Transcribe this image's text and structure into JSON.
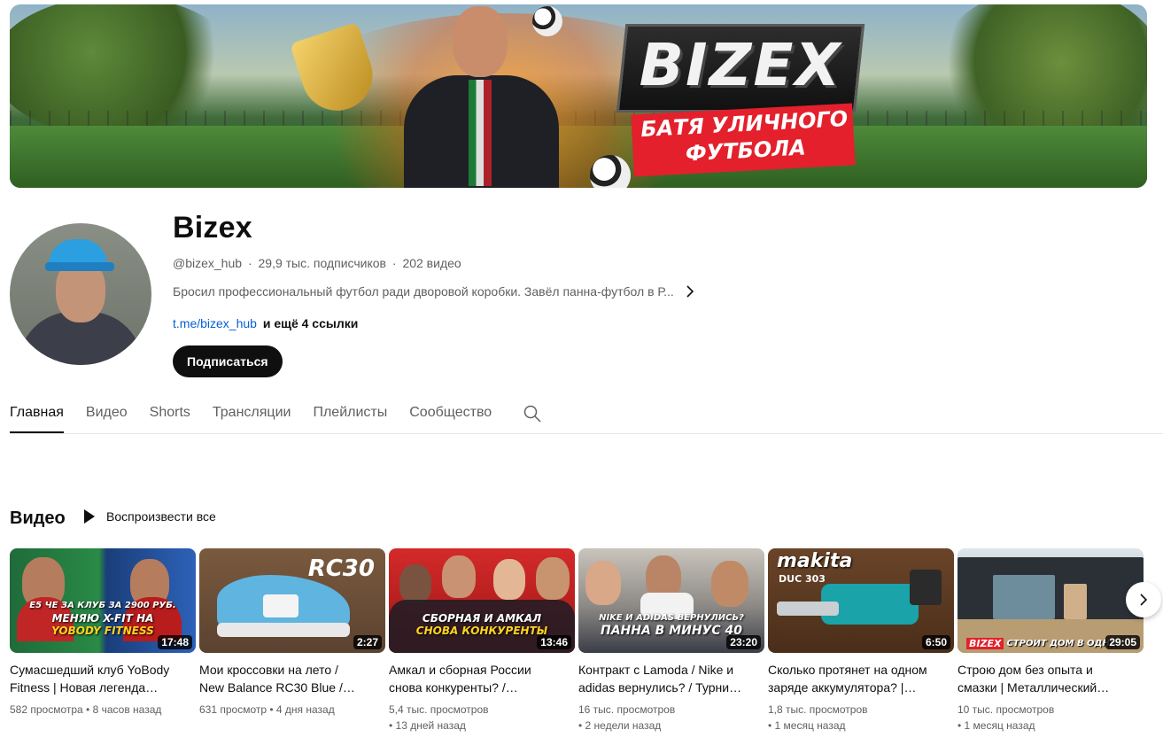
{
  "banner": {
    "logo": "BIZEX",
    "subtitle_line1": "БАТЯ УЛИЧНОГО",
    "subtitle_line2": "ФУТБОЛА"
  },
  "channel": {
    "name": "Bizex",
    "handle": "@bizex_hub",
    "subscribers": "29,9 тыс. подписчиков",
    "video_count": "202 видео",
    "separator": "·",
    "description": "Бросил профессиональный футбол ради дворовой коробки. Завёл панна-футбол в Р...",
    "link": "t.me/bizex_hub",
    "more_links": "и ещё 4 ссылки",
    "subscribe_label": "Подписаться"
  },
  "tabs": [
    {
      "label": "Главная",
      "active": true
    },
    {
      "label": "Видео",
      "active": false
    },
    {
      "label": "Shorts",
      "active": false
    },
    {
      "label": "Трансляции",
      "active": false
    },
    {
      "label": "Плейлисты",
      "active": false
    },
    {
      "label": "Сообщество",
      "active": false
    }
  ],
  "section": {
    "title": "Видео",
    "play_all": "Воспроизвести все"
  },
  "videos": [
    {
      "title_line1": "Сумасшедший клуб YoBody",
      "title_line2": "Fitness | Новая легенда…",
      "meta_line1": "582 просмотра • 8 часов назад",
      "meta_line2": "",
      "duration": "17:48",
      "thumb_text1": "Е5 ЧЕ ЗА КЛУБ ЗА 2900 РУБ.",
      "thumb_text2": "МЕНЯЮ X-FIT НА",
      "thumb_text3": "YOBODY FITNESS"
    },
    {
      "title_line1": "Мои кроссовки на лето /",
      "title_line2": "New Balance RC30 Blue /…",
      "meta_line1": "631 просмотр • 4 дня назад",
      "meta_line2": "",
      "duration": "2:27",
      "thumb_text1": "RC30"
    },
    {
      "title_line1": "Амкал и сборная России",
      "title_line2": "снова конкуренты? /…",
      "meta_line1": "5,4 тыс. просмотров",
      "meta_line2": "• 13 дней назад",
      "duration": "13:46",
      "thumb_text1": "СБОРНАЯ И АМКАЛ",
      "thumb_text2": "СНОВА КОНКУРЕНТЫ"
    },
    {
      "title_line1": "Контракт с Lamoda / Nike и",
      "title_line2": "adidas вернулись? / Турни…",
      "meta_line1": "16 тыс. просмотров",
      "meta_line2": "• 2 недели назад",
      "duration": "23:20",
      "thumb_text1": "NIKE И ADIDAS ВЕРНУЛИСЬ?",
      "thumb_text2": "ПАННА В МИНУС 40"
    },
    {
      "title_line1": "Сколько протянет на одном",
      "title_line2": "заряде аккумулятора? |…",
      "meta_line1": "1,8 тыс. просмотров",
      "meta_line2": "• 1 месяц назад",
      "duration": "6:50",
      "thumb_text1": "makita",
      "thumb_text2": "DUC 303"
    },
    {
      "title_line1": "Строю дом без опыта и",
      "title_line2": "смазки | Металлический…",
      "meta_line1": "10 тыс. просмотров",
      "meta_line2": "• 1 месяц назад",
      "duration": "29:05",
      "thumb_text1": "BIZEX",
      "thumb_text2": "СТРОИТ ДОМ В ОДНИ"
    }
  ],
  "colors": {
    "link": "#065fd4",
    "text_primary": "#0f0f0f",
    "text_secondary": "#606060",
    "accent_red": "#e3202c"
  }
}
